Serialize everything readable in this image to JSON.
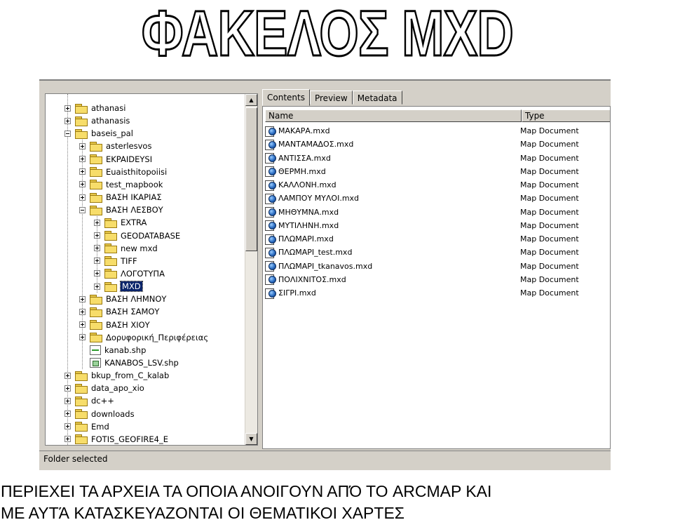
{
  "heading": "ΦΑΚΕΛΟΣ MXD",
  "window": {
    "status_text": "Folder selected",
    "tabs": [
      "Contents",
      "Preview",
      "Metadata"
    ],
    "columns": {
      "name": "Name",
      "type": "Type"
    }
  },
  "tree": [
    {
      "label": "athanasi",
      "icon": "folder",
      "toggle": "plus",
      "depth": 1
    },
    {
      "label": "athanasis",
      "icon": "folder",
      "toggle": "plus",
      "depth": 1
    },
    {
      "label": "baseis_pal",
      "icon": "folder",
      "toggle": "minus",
      "depth": 1
    },
    {
      "label": "asterlesvos",
      "icon": "folder",
      "toggle": "plus",
      "depth": 2
    },
    {
      "label": "EKPAIDEYSI",
      "icon": "folder",
      "toggle": "plus",
      "depth": 2
    },
    {
      "label": "Euaisthitopoiisi",
      "icon": "folder",
      "toggle": "plus",
      "depth": 2
    },
    {
      "label": "test_mapbook",
      "icon": "folder",
      "toggle": "plus",
      "depth": 2
    },
    {
      "label": "ΒΑΣΗ ΙΚΑΡΙΑΣ",
      "icon": "folder",
      "toggle": "plus",
      "depth": 2
    },
    {
      "label": "ΒΑΣΗ ΛΕΣΒΟΥ",
      "icon": "folder",
      "toggle": "minus",
      "depth": 2
    },
    {
      "label": "EXTRA",
      "icon": "folder",
      "toggle": "plus",
      "depth": 3
    },
    {
      "label": "GEODATABASE",
      "icon": "folder",
      "toggle": "plus",
      "depth": 3
    },
    {
      "label": "new mxd",
      "icon": "folder",
      "toggle": "plus",
      "depth": 3
    },
    {
      "label": "TIFF",
      "icon": "folder",
      "toggle": "plus",
      "depth": 3
    },
    {
      "label": "ΛΟΓΟΤΥΠΑ",
      "icon": "folder",
      "toggle": "plus",
      "depth": 3
    },
    {
      "label": "MXD",
      "icon": "folder",
      "toggle": "plus",
      "depth": 3,
      "selected": true
    },
    {
      "label": "ΒΑΣΗ ΛΗΜΝΟΥ",
      "icon": "folder",
      "toggle": "plus",
      "depth": 2
    },
    {
      "label": "ΒΑΣΗ ΣΑΜΟΥ",
      "icon": "folder",
      "toggle": "plus",
      "depth": 2
    },
    {
      "label": "ΒΑΣΗ ΧΙΟΥ",
      "icon": "folder",
      "toggle": "plus",
      "depth": 2
    },
    {
      "label": "Δορυφορική_Περιφέρειας",
      "icon": "folder",
      "toggle": "plus",
      "depth": 2
    },
    {
      "label": "kanab.shp",
      "icon": "shapefile-line",
      "toggle": "none",
      "depth": 2
    },
    {
      "label": "KANABOS_LSV.shp",
      "icon": "shapefile-polygon",
      "toggle": "none",
      "depth": 2
    },
    {
      "label": "bkup_from_C_kalab",
      "icon": "folder",
      "toggle": "plus",
      "depth": 1
    },
    {
      "label": "data_apo_xio",
      "icon": "folder",
      "toggle": "plus",
      "depth": 1
    },
    {
      "label": "dc++",
      "icon": "folder",
      "toggle": "plus",
      "depth": 1
    },
    {
      "label": "downloads",
      "icon": "folder",
      "toggle": "plus",
      "depth": 1
    },
    {
      "label": "Emd",
      "icon": "folder",
      "toggle": "plus",
      "depth": 1
    },
    {
      "label": "FOTIS_GEOFIRE4_E",
      "icon": "folder",
      "toggle": "plus",
      "depth": 1
    }
  ],
  "files": [
    {
      "name": "ΜΑΚΑΡΑ.mxd",
      "type": "Map Document"
    },
    {
      "name": "ΜΑΝΤΑΜΑΔΟΣ.mxd",
      "type": "Map Document"
    },
    {
      "name": "ΑΝΤΙΣΣΑ.mxd",
      "type": "Map Document"
    },
    {
      "name": "ΘΕΡΜΗ.mxd",
      "type": "Map Document"
    },
    {
      "name": "ΚΑΛΛΟΝΗ.mxd",
      "type": "Map Document"
    },
    {
      "name": "ΛΑΜΠΟΥ ΜΥΛΟΙ.mxd",
      "type": "Map Document"
    },
    {
      "name": "ΜΗΘΥΜΝΑ.mxd",
      "type": "Map Document"
    },
    {
      "name": "ΜΥΤΙΛΗΝΗ.mxd",
      "type": "Map Document"
    },
    {
      "name": "ΠΛΩΜΑΡΙ.mxd",
      "type": "Map Document"
    },
    {
      "name": "ΠΛΩΜΑΡΙ_test.mxd",
      "type": "Map Document"
    },
    {
      "name": "ΠΛΩΜΑΡΙ_tkanavos.mxd",
      "type": "Map Document"
    },
    {
      "name": "ΠΟΛΙΧΝΙΤΟΣ.mxd",
      "type": "Map Document"
    },
    {
      "name": "ΣΙΓΡΙ.mxd",
      "type": "Map Document"
    }
  ],
  "caption": {
    "line1": "ΠΕΡΙΕΧΕΙ ΤΑ ΑΡΧΕΙΑ ΤΑ ΟΠΟΙΑ ΑΝΟΙΓΟΥΝ ΑΠΌ ΤΟ ARCMAP ΚΑΙ",
    "line2": "ΜΕ ΑΥΤΆ ΚΑΤΑΣΚΕΥΑΖΟΝΤΑΙ ΟΙ ΘΕΜΑΤΙΚΟΙ ΧΑΡΤΕΣ"
  }
}
